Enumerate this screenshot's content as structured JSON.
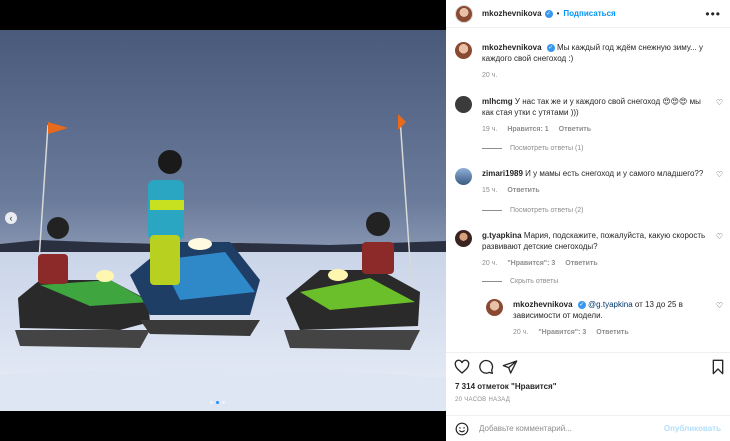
{
  "header": {
    "username": "mkozhevnikova",
    "follow_label": "Подписаться",
    "more_icon": "ellipsis-icon"
  },
  "post": {
    "caption_user": "mkozhevnikova",
    "caption_text": "Мы каждый год ждём снежную зиму... у каждого свой снегоход :)",
    "caption_time": "20 ч."
  },
  "comments": [
    {
      "user": "mlhcmg",
      "text": "У нас так же и у каждого свой снегоход 😍😍😍 мы как стая утки с утятами )))",
      "time": "19 ч.",
      "likes": "Нравится: 1",
      "reply": "Ответить",
      "replies_label": "Посмотреть ответы (1)"
    },
    {
      "user": "zimari1989",
      "text": "И у мамы есть снегоход и у самого младшего??",
      "time": "15 ч.",
      "reply": "Ответить",
      "replies_label": "Посмотреть ответы (2)"
    },
    {
      "user": "g.tyapkina",
      "text": "Мария, подскажите, пожалуйста, какую скорость развивают детские снегоходы?",
      "time": "20 ч.",
      "likes": "\"Нравится\": 3",
      "reply": "Ответить",
      "replies_label": "Скрыть ответы"
    }
  ],
  "reply": {
    "user": "mkozhevnikova",
    "mention": "@g.tyapkina",
    "text": "от 13 до 25 в зависимости от модели.",
    "time": "20 ч.",
    "likes": "\"Нравится\": 3",
    "reply": "Ответить"
  },
  "footer": {
    "likes": "7 314 отметок \"Нравится\"",
    "time_ago": "20 ЧАСОВ НАЗАД",
    "comment_placeholder": "Добавьте комментарий...",
    "publish_label": "Опубликовать"
  },
  "icons": {
    "actions": [
      "heart-icon",
      "comment-icon",
      "share-icon",
      "bookmark-icon"
    ],
    "emoji": "emoji-icon"
  },
  "colors": {
    "accent": "#0095f6",
    "verified": "#3897f0",
    "muted": "#8e8e8e"
  }
}
